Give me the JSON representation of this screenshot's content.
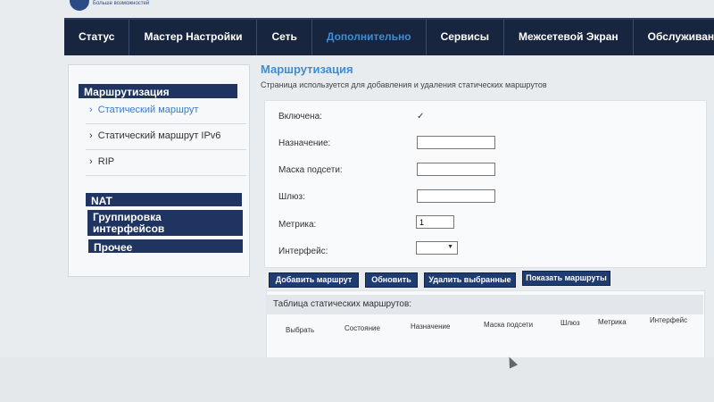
{
  "brand": {
    "tagline": "Больше возможностей"
  },
  "nav": [
    {
      "label": "Статус"
    },
    {
      "label": "Мастер Настройки"
    },
    {
      "label": "Сеть"
    },
    {
      "label": "Дополнительно",
      "active": true
    },
    {
      "label": "Сервисы"
    },
    {
      "label": "Межсетевой Экран"
    },
    {
      "label": "Обслуживание"
    }
  ],
  "sidebar": {
    "routing_header": "Маршрутизация",
    "items": [
      {
        "label": "Статический маршрут",
        "active": true
      },
      {
        "label": "Статический маршрут IPv6"
      },
      {
        "label": "RIP"
      }
    ],
    "nat_header": "NAT",
    "iface_group_header_1": "Группировка",
    "iface_group_header_2": "интерфейсов",
    "other_header": "Прочее"
  },
  "main": {
    "title": "Маршрутизация",
    "description": "Страница используется для добавления и удаления статических маршрутов"
  },
  "form": {
    "enabled_label": "Включена:",
    "enabled_checked": true,
    "checkmark": "✓",
    "destination_label": "Назначение:",
    "destination_value": "",
    "mask_label": "Маска подсети:",
    "mask_value": "",
    "gateway_label": "Шлюз:",
    "gateway_value": "",
    "metric_label": "Метрика:",
    "metric_value": "1",
    "interface_label": "Интерфейс:",
    "interface_value": ""
  },
  "buttons": {
    "add": "Добавить маршрут",
    "refresh": "Обновить",
    "delete": "Удалить выбранные",
    "show": "Показать маршруты"
  },
  "table": {
    "caption": "Таблица статических маршрутов:",
    "headers": [
      "Выбрать",
      "Состояние",
      "Назначение",
      "Маска подсети",
      "Шлюз",
      "Метрика",
      "Интерфейс"
    ]
  }
}
